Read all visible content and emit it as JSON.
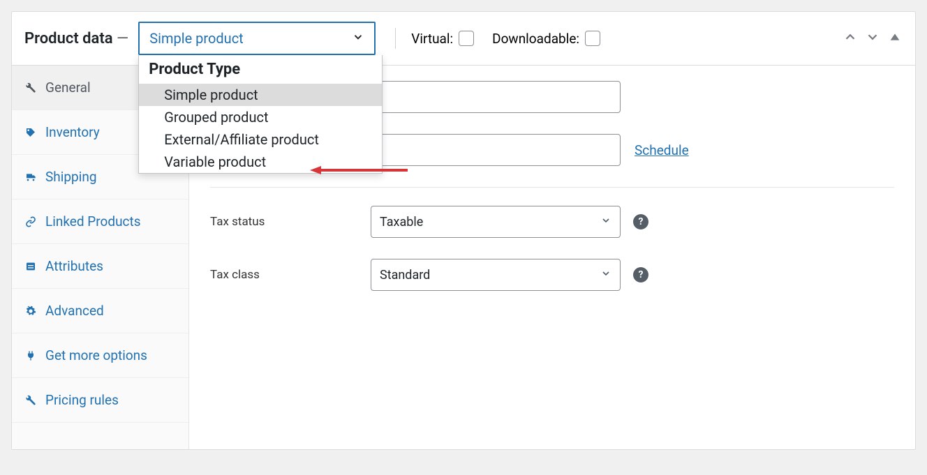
{
  "header": {
    "title": "Product data",
    "dash": " — ",
    "select_value": "Simple product",
    "virtual_label": "Virtual:",
    "downloadable_label": "Downloadable:"
  },
  "dropdown": {
    "group": "Product Type",
    "options": [
      "Simple product",
      "Grouped product",
      "External/Affiliate product",
      "Variable product"
    ]
  },
  "sidebar": {
    "tabs": [
      "General",
      "Inventory",
      "Shipping",
      "Linked Products",
      "Attributes",
      "Advanced",
      "Get more options",
      "Pricing rules"
    ]
  },
  "form": {
    "regular_label": "",
    "sale_label": "",
    "tax_status_label": "Tax status",
    "tax_status_value": "Taxable",
    "tax_class_label": "Tax class",
    "tax_class_value": "Standard",
    "schedule": "Schedule"
  },
  "help_glyph": "?"
}
